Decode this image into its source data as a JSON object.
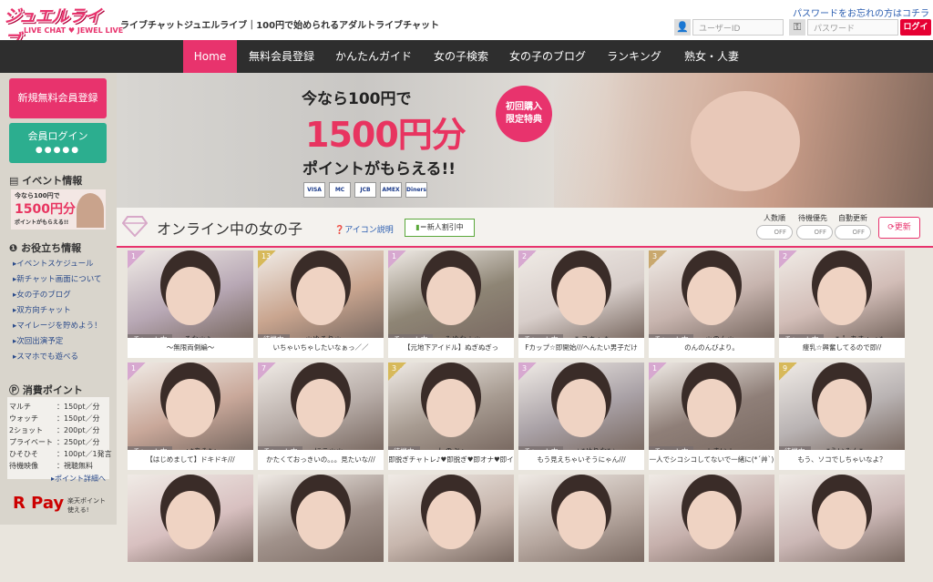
{
  "header": {
    "logo_text": "ジュエルライブ",
    "logo_sub": "LIVE CHAT ♥ JEWEL LIVE",
    "tagline": "ライブチャットジュエルライブ｜100円で始められるアダルトライブチャット",
    "forgot": "パスワードをお忘れの方はコチラ",
    "user_placeholder": "ユーザーID",
    "pass_placeholder": "パスワード",
    "login": "ログイン"
  },
  "nav": [
    "Home",
    "無料会員登録",
    "かんたんガイド",
    "女の子検索",
    "女の子のブログ",
    "ランキング",
    "熟女・人妻"
  ],
  "side": {
    "register": "新規無料会員登録",
    "login": "会員ログイン",
    "event_title": "イベント情報",
    "event_banner": [
      "今なら100円で",
      "1500円分",
      "ポイントがもらえる!!"
    ],
    "help_title": "お役立ち情報",
    "help_links": [
      "イベントスケジュール",
      "新チャット画面について",
      "女の子のブログ",
      "双方向チャット",
      "マイレージを貯めよう！",
      "次回出演予定",
      "スマホでも遊べる"
    ],
    "points_title": "消費ポイント",
    "points": [
      [
        "マルチ",
        "：150pt／分"
      ],
      [
        "ウォッチ",
        "：150pt／分"
      ],
      [
        "2ショット",
        "：200pt／分"
      ],
      [
        "プライベート",
        "：250pt／分"
      ],
      [
        "ひそひそ",
        "：100pt／1発言"
      ],
      [
        "待機映像",
        "：視聴無料"
      ]
    ],
    "points_detail": "ポイント詳細へ",
    "rpay": "R Pay",
    "rpay_note": [
      "楽天ポイント",
      "使える!"
    ]
  },
  "banner": {
    "line1": "今なら100円で",
    "line2": "1500円分",
    "line3": "ポイントがもらえる!!",
    "badge": [
      "初回購入",
      "限定特典"
    ],
    "cards": [
      "VISA",
      "MC",
      "JCB",
      "AMEX",
      "Diners"
    ]
  },
  "section": {
    "title": "オンライン中の女の子",
    "icon_help": "アイコン説明",
    "new_badge": "＝新人割引中",
    "toggles": [
      {
        "label": "人数順",
        "state": "OFF"
      },
      {
        "label": "待機優先",
        "state": "OFF"
      },
      {
        "label": "自動更新",
        "state": "OFF"
      }
    ],
    "refresh": "更新"
  },
  "tiles": [
    {
      "num": "1",
      "status": "チャット中",
      "name": "るな＊♪",
      "caption": "～無限両側編～",
      "nc": "",
      "bg": "#b8a8b5"
    },
    {
      "num": "13",
      "status": "待機中",
      "name": "＊ゆるり＊。",
      "caption": "いちゃいちゃしたいなぁっ／／",
      "nc": "y",
      "bg": "#c9a58f"
    },
    {
      "num": "1",
      "status": "チャット中",
      "name": "みゆな＋＊。",
      "caption": "【元地下アイドル】ぬぎぬぎっ",
      "nc": "",
      "bg": "#8e8575"
    },
    {
      "num": "2",
      "status": "チャット中",
      "name": "*-ユキ+-*",
      "caption": "Fカップ☆即開始///へんたい男子だけ",
      "nc": "",
      "bg": "#d7cdc9"
    },
    {
      "num": "3",
      "status": "チャット中",
      "name": "＊のん＊。",
      "caption": "のんのんびより。",
      "nc": "g",
      "bg": "#c7b4ae"
    },
    {
      "num": "2",
      "status": "チャット中",
      "name": "*･゜あき+-+*",
      "caption": "痩乳☆興奮してるので即//",
      "nc": "",
      "bg": "#d2bdb7"
    },
    {
      "num": "1",
      "status": "チャット中",
      "name": "+*あみ*+",
      "caption": "【はじめまして】ドキドキ///",
      "nc": "",
      "bg": "#c9a89a"
    },
    {
      "num": "7",
      "status": "チャット中",
      "name": "にこ＊＊",
      "caption": "かたくておっきいの。。。見たいな///",
      "nc": "",
      "bg": "#b7aca7"
    },
    {
      "num": "3",
      "status": "待機中",
      "name": ".しのぶ+.",
      "caption": "即脱ぎチャトレ♪♥即脱ぎ♥即オナ♥即イ",
      "nc": "y",
      "bg": "#a79b91"
    },
    {
      "num": "3",
      "status": "チャット中",
      "name": "☆*せりな*☆",
      "caption": "もう見えちゃいそうにゃん///",
      "nc": "",
      "bg": "#a9a1a6"
    },
    {
      "num": "1",
      "status": "チャット中",
      "name": "＋まい＋。",
      "caption": "一人でシコシコしてないで一緒に(*´艸`)",
      "nc": "",
      "bg": "#8f7f78"
    },
    {
      "num": "9",
      "status": "待機中",
      "name": "*えいみん*",
      "caption": "もう、ソコでしちゃいなよ？",
      "nc": "y",
      "bg": "#b9b3b3"
    },
    {
      "num": "",
      "status": "",
      "name": "",
      "caption": "",
      "nc": "p",
      "bg": "#d8c0c0"
    },
    {
      "num": "",
      "status": "",
      "name": "",
      "caption": "",
      "nc": "",
      "bg": "#a0918a"
    },
    {
      "num": "",
      "status": "",
      "name": "",
      "caption": "",
      "nc": "",
      "bg": "#c7b6ad"
    },
    {
      "num": "",
      "status": "",
      "name": "",
      "caption": "",
      "nc": "",
      "bg": "#b7a8a0"
    },
    {
      "num": "",
      "status": "",
      "name": "",
      "caption": "",
      "nc": "",
      "bg": "#c6b0ac"
    },
    {
      "num": "",
      "status": "",
      "name": "",
      "caption": "",
      "nc": "p",
      "bg": "#cbb7b5"
    }
  ]
}
